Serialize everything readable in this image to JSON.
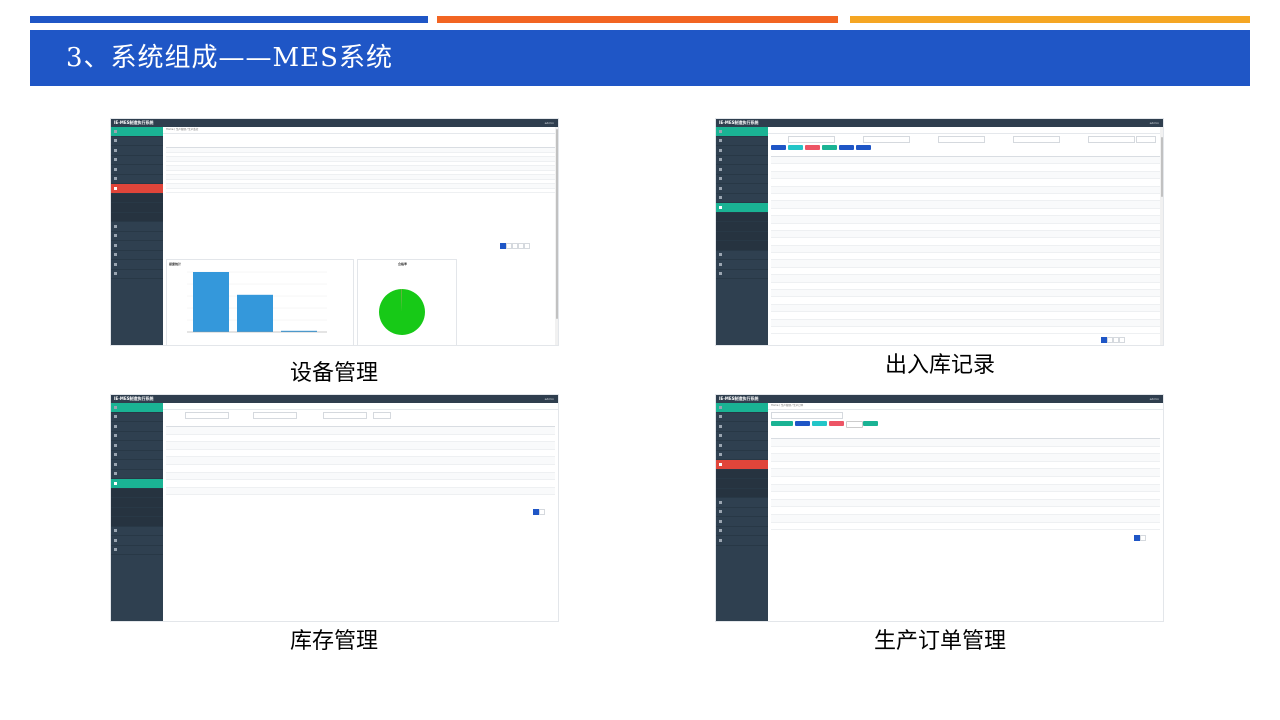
{
  "colors": {
    "stripe1": "#1f56c6",
    "stripe2": "#f26522",
    "stripe3": "#f5a623",
    "title_bar": "#1f56c6",
    "sidebar": "#2f4050",
    "active": "#e0453a",
    "bar": "#3498db",
    "pie": "#17c917"
  },
  "slide": {
    "title": "3、系统组成——MES系统"
  },
  "screenshots": [
    {
      "caption": "设备管理",
      "logo": "IE-MES制造执行系统",
      "user": "admin"
    },
    {
      "caption": "出入库记录",
      "logo": "IE-MES制造执行系统",
      "user": "admin"
    },
    {
      "caption": "库存管理",
      "logo": "IE-MES制造执行系统",
      "user": "admin"
    },
    {
      "caption": "生产订单管理",
      "logo": "IE-MES制造执行系统",
      "user": "admin"
    }
  ],
  "shot1": {
    "breadcrumb": "Home / 生产管理 / 生产监控",
    "chart1_title": "报废统计",
    "chart2_title": "合格率",
    "chart_data": [
      {
        "type": "bar",
        "title": "报废统计",
        "categories": [
          "",
          "",
          ""
        ],
        "values": [
          100,
          62,
          2
        ],
        "ylim": [
          0,
          100
        ]
      },
      {
        "type": "pie",
        "title": "合格率",
        "values": [
          99.8,
          0.2
        ]
      }
    ]
  },
  "shot4": {
    "breadcrumb": "Home / 生产管理 / 生产订单"
  }
}
